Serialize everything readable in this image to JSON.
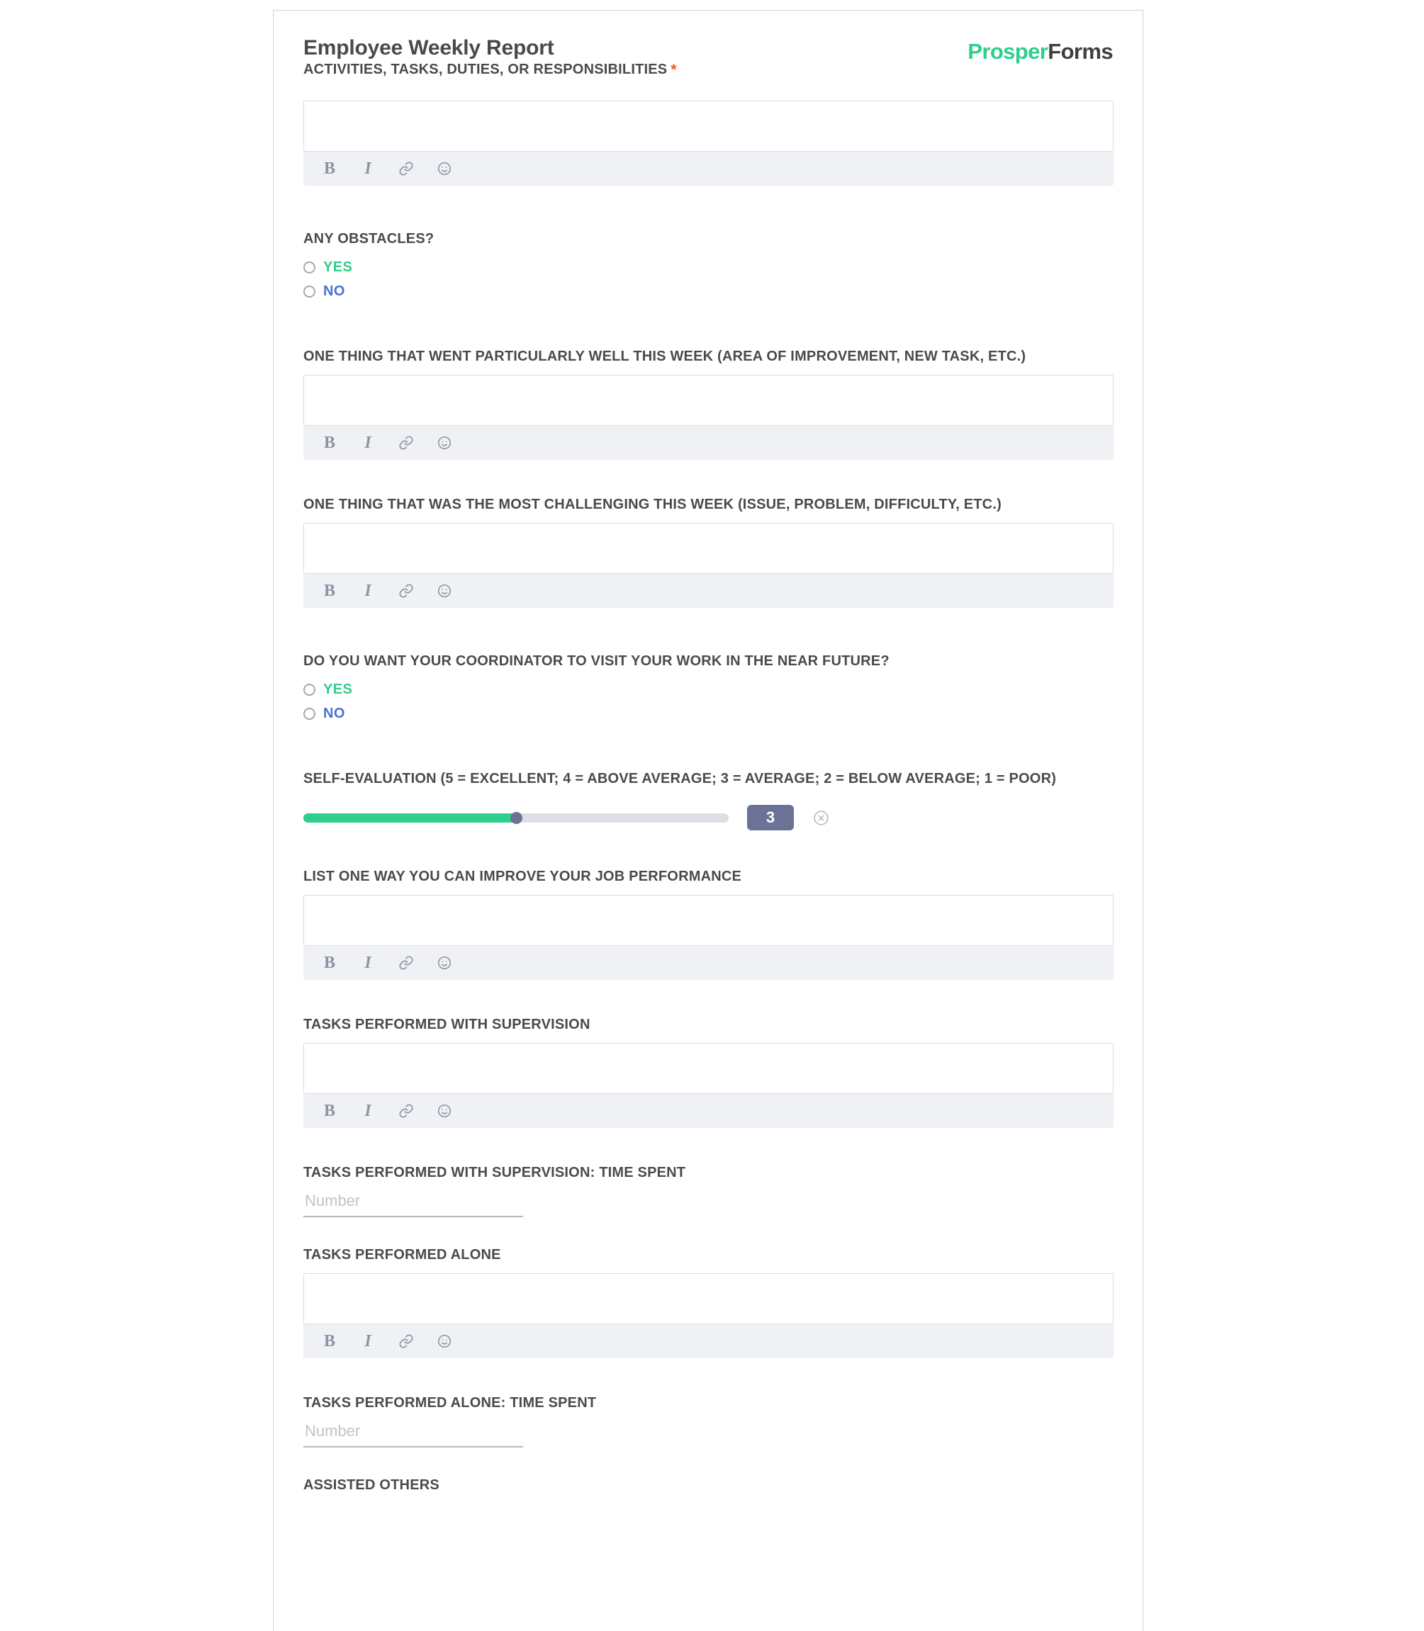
{
  "brand": {
    "logo_prosper": "Prosper",
    "logo_forms": "Forms",
    "accent_green": "#2ece8b",
    "accent_blue": "#4a72d4",
    "required_star": "#ec5d2b",
    "slider_badge_bg": "#6a7296"
  },
  "header": {
    "title": "Employee Weekly Report",
    "close_icon": "close-circle-icon"
  },
  "toolbar": {
    "bold": "B",
    "italic": "I",
    "link_icon": "link-icon",
    "emoji_icon": "emoji-icon"
  },
  "fields": {
    "activities": {
      "label": "ACTIVITIES, TASKS, DUTIES, OR RESPONSIBILITIES",
      "required_marker": "*",
      "value": ""
    },
    "obstacles": {
      "label": "ANY OBSTACLES?",
      "options": [
        {
          "label": "YES",
          "selected": false
        },
        {
          "label": "NO",
          "selected": false
        }
      ]
    },
    "went_well": {
      "label": "ONE THING THAT WENT PARTICULARLY WELL THIS WEEK (AREA OF IMPROVEMENT, NEW TASK, ETC.)",
      "value": ""
    },
    "most_challenging": {
      "label": "ONE THING THAT WAS THE MOST CHALLENGING THIS WEEK (ISSUE, PROBLEM, DIFFICULTY, ETC.)",
      "value": ""
    },
    "coordinator_visit": {
      "label": "DO YOU WANT YOUR COORDINATOR TO VISIT YOUR WORK IN THE NEAR FUTURE?",
      "options": [
        {
          "label": "YES",
          "selected": false
        },
        {
          "label": "NO",
          "selected": false
        }
      ]
    },
    "self_evaluation": {
      "label": "SELF-EVALUATION (5 = EXCELLENT; 4 = ABOVE AVERAGE; 3 = AVERAGE; 2 = BELOW AVERAGE; 1 = POOR)",
      "value": "3",
      "min": 1,
      "max": 5,
      "fill_percent": 50,
      "clear_icon": "clear-circle-icon"
    },
    "improve_performance": {
      "label": "LIST ONE WAY YOU CAN IMPROVE YOUR JOB PERFORMANCE",
      "value": ""
    },
    "tasks_with_supervision": {
      "label": "TASKS PERFORMED WITH SUPERVISION",
      "value": ""
    },
    "tasks_with_supervision_time": {
      "label": "TASKS PERFORMED WITH SUPERVISION: TIME SPENT",
      "placeholder": "Number",
      "value": ""
    },
    "tasks_alone": {
      "label": "TASKS PERFORMED ALONE",
      "value": ""
    },
    "tasks_alone_time": {
      "label": "TASKS PERFORMED ALONE: TIME SPENT",
      "placeholder": "Number",
      "value": ""
    },
    "assisted_others": {
      "label": "ASSISTED OTHERS"
    }
  }
}
